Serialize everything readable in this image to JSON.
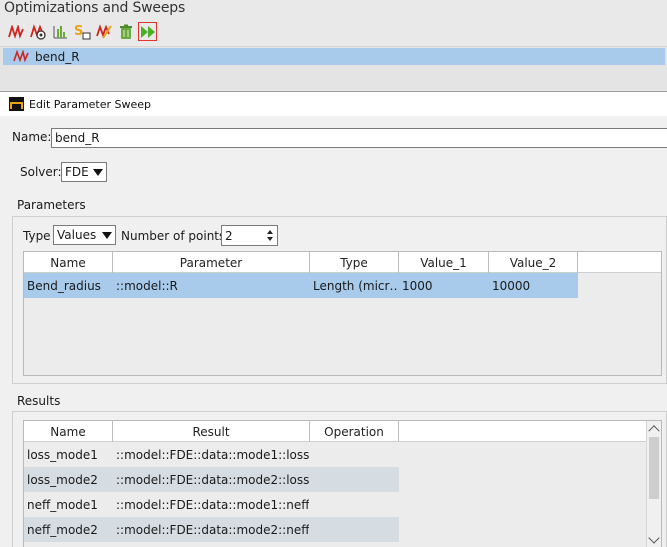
{
  "panel": {
    "title": "Optimizations and Sweeps",
    "toolbar": [
      {
        "name": "new-sweep-icon"
      },
      {
        "name": "new-optimization-icon"
      },
      {
        "name": "nested-sweep-icon"
      },
      {
        "name": "sweep-settings-icon"
      },
      {
        "name": "edit-icon"
      },
      {
        "name": "delete-icon"
      },
      {
        "name": "run-icon"
      }
    ],
    "sweeps": [
      {
        "label": "bend_R"
      }
    ]
  },
  "dialog": {
    "title": "Edit Parameter Sweep",
    "name_label": "Name:",
    "name_value": "bend_R",
    "solver_label": "Solver:",
    "solver_value": "FDE",
    "parameters": {
      "title": "Parameters",
      "type_label": "Type",
      "type_value": "Values",
      "npoints_label": "Number of points:",
      "npoints_value": "2",
      "columns": [
        "Name",
        "Parameter",
        "Type",
        "Value_1",
        "Value_2"
      ],
      "rows": [
        {
          "name": "Bend_radius",
          "parameter": "::model::R",
          "type": "Length (micr…",
          "value_1": "1000",
          "value_2": "10000"
        }
      ]
    },
    "results": {
      "title": "Results",
      "columns": [
        "Name",
        "Result",
        "Operation"
      ],
      "rows": [
        {
          "name": "loss_mode1",
          "result": "::model::FDE::data::mode1::loss",
          "operation": ""
        },
        {
          "name": "loss_mode2",
          "result": "::model::FDE::data::mode2::loss",
          "operation": ""
        },
        {
          "name": "neff_mode1",
          "result": "::model::FDE::data::mode1::neff",
          "operation": ""
        },
        {
          "name": "neff_mode2",
          "result": "::model::FDE::data::mode2::neff",
          "operation": ""
        }
      ]
    }
  }
}
